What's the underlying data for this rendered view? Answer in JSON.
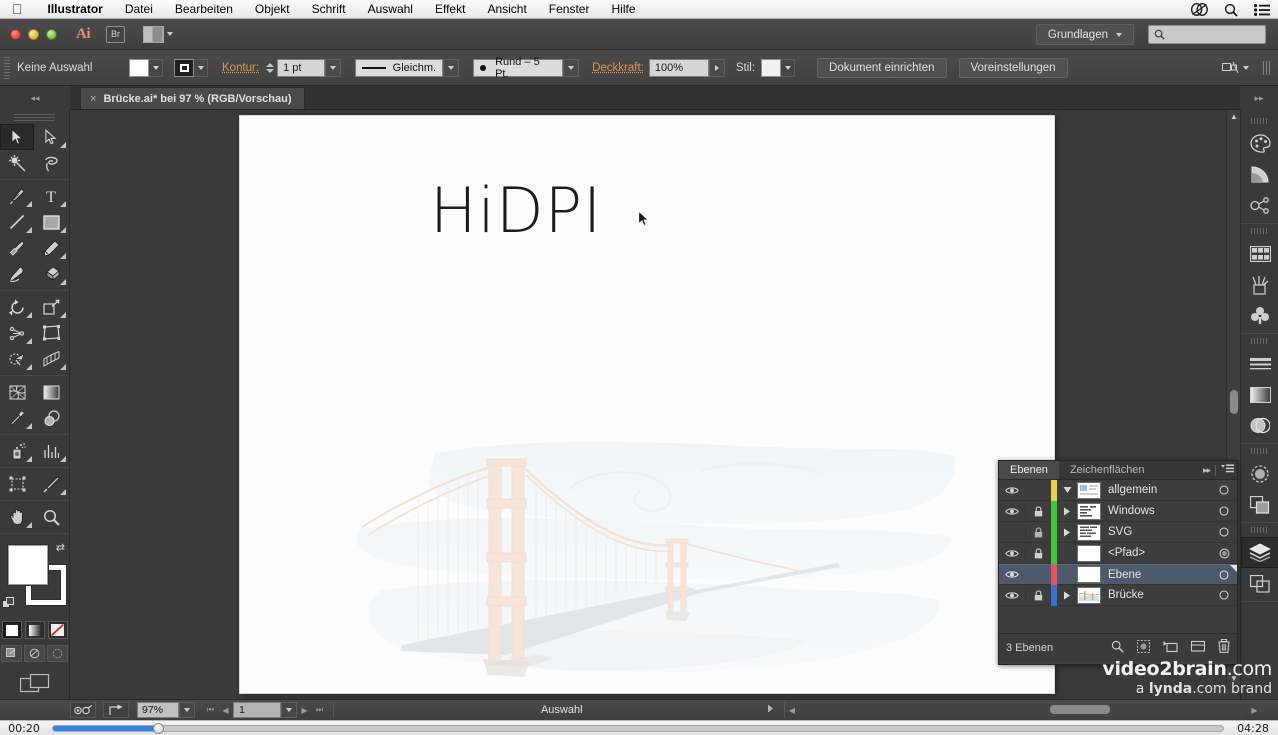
{
  "mac_menu": {
    "apple_icon": "apple-logo-icon",
    "items": [
      {
        "label": "Illustrator",
        "bold": true
      },
      {
        "label": "Datei",
        "bold": false
      },
      {
        "label": "Bearbeiten",
        "bold": false
      },
      {
        "label": "Objekt",
        "bold": false
      },
      {
        "label": "Schrift",
        "bold": false
      },
      {
        "label": "Auswahl",
        "bold": false
      },
      {
        "label": "Effekt",
        "bold": false
      },
      {
        "label": "Ansicht",
        "bold": false
      },
      {
        "label": "Fenster",
        "bold": false
      },
      {
        "label": "Hilfe",
        "bold": false
      }
    ],
    "right_icons": [
      "creative-cloud-icon",
      "spotlight-search-icon",
      "notification-list-icon"
    ]
  },
  "appbar": {
    "window_controls": [
      "close",
      "minimize",
      "zoom"
    ],
    "app_logo": "Ai",
    "bridge_button": "Br",
    "arrange_documents": "arrange-documents-icon",
    "workspace_label": "Grundlagen",
    "search_placeholder": ""
  },
  "control_bar": {
    "selection_status": "Keine Auswahl",
    "fill_color": "#ffffff",
    "stroke_label": "Kontur:",
    "stroke_weight": "1 pt",
    "stroke_profile": "Gleichm.",
    "brush_definition": "Rund – 5 Pt.",
    "opacity_label": "Deckkraft:",
    "opacity_value": "100%",
    "style_label": "Stil:",
    "document_setup_button": "Dokument einrichten",
    "preferences_button": "Voreinstellungen"
  },
  "tabs": {
    "document": {
      "title": "Brücke.ai* bei 97 % (RGB/Vorschau)",
      "close": "×"
    }
  },
  "canvas": {
    "artwork_text": "HiDPI",
    "artwork_illustration": "golden-gate-bridge-watercolor"
  },
  "tools": {
    "rows": [
      [
        {
          "name": "selection-tool",
          "icon": "arrow-solid",
          "selected": true,
          "flyout": false
        },
        {
          "name": "direct-selection-tool",
          "icon": "arrow-outline",
          "selected": false,
          "flyout": true
        }
      ],
      [
        {
          "name": "magic-wand-tool",
          "icon": "magic-wand",
          "selected": false,
          "flyout": false
        },
        {
          "name": "lasso-tool",
          "icon": "lasso",
          "selected": false,
          "flyout": false
        }
      ],
      [
        {
          "name": "pen-tool",
          "icon": "pen-nib",
          "selected": false,
          "flyout": true
        },
        {
          "name": "type-tool",
          "icon": "type-T",
          "selected": false,
          "flyout": true
        }
      ],
      [
        {
          "name": "line-segment-tool",
          "icon": "line-diagonal",
          "selected": false,
          "flyout": true
        },
        {
          "name": "rectangle-tool",
          "icon": "rectangle",
          "selected": false,
          "flyout": true
        }
      ],
      [
        {
          "name": "paintbrush-tool",
          "icon": "paintbrush",
          "selected": false,
          "flyout": false
        },
        {
          "name": "pencil-tool",
          "icon": "pencil",
          "selected": false,
          "flyout": true
        }
      ],
      [
        {
          "name": "blob-brush-tool",
          "icon": "blob-brush",
          "selected": false,
          "flyout": false
        },
        {
          "name": "eraser-tool",
          "icon": "eraser",
          "selected": false,
          "flyout": true
        }
      ],
      [
        {
          "name": "rotate-tool",
          "icon": "rotate",
          "selected": false,
          "flyout": true
        },
        {
          "name": "scale-tool",
          "icon": "scale",
          "selected": false,
          "flyout": true
        }
      ],
      [
        {
          "name": "width-tool",
          "icon": "width",
          "selected": false,
          "flyout": true
        },
        {
          "name": "free-transform-tool",
          "icon": "free-transform",
          "selected": false,
          "flyout": false
        }
      ],
      [
        {
          "name": "shape-builder-tool",
          "icon": "shape-builder",
          "selected": false,
          "flyout": true
        },
        {
          "name": "perspective-grid-tool",
          "icon": "perspective-grid",
          "selected": false,
          "flyout": true
        }
      ],
      [
        {
          "name": "mesh-tool",
          "icon": "mesh",
          "selected": false,
          "flyout": false
        },
        {
          "name": "gradient-tool",
          "icon": "gradient",
          "selected": false,
          "flyout": false
        }
      ],
      [
        {
          "name": "eyedropper-tool",
          "icon": "eyedropper",
          "selected": false,
          "flyout": true
        },
        {
          "name": "blend-tool",
          "icon": "blend",
          "selected": false,
          "flyout": false
        }
      ],
      [
        {
          "name": "symbol-sprayer-tool",
          "icon": "symbol-sprayer",
          "selected": false,
          "flyout": true
        },
        {
          "name": "column-graph-tool",
          "icon": "bar-graph",
          "selected": false,
          "flyout": true
        }
      ],
      [
        {
          "name": "artboard-tool",
          "icon": "artboard",
          "selected": false,
          "flyout": false
        },
        {
          "name": "slice-tool",
          "icon": "slice-knife",
          "selected": false,
          "flyout": true
        }
      ],
      [
        {
          "name": "hand-tool",
          "icon": "hand",
          "selected": false,
          "flyout": true
        },
        {
          "name": "zoom-tool",
          "icon": "magnifier",
          "selected": false,
          "flyout": false
        }
      ]
    ],
    "fill_color": "#ffffff",
    "stroke_color": "#ffffff",
    "paint_modes": [
      "color-swatch",
      "gradient-swatch",
      "none-swatch"
    ],
    "screen_modes": [
      "normal-screen-mode",
      "full-screen-menu-bar",
      "full-screen-mode"
    ]
  },
  "right_dock": {
    "groups": [
      [
        {
          "name": "color-panel-icon"
        },
        {
          "name": "color-guide-panel-icon"
        },
        {
          "name": "edit-colors-panel-icon"
        }
      ],
      [
        {
          "name": "swatches-panel-icon"
        },
        {
          "name": "brushes-panel-icon"
        },
        {
          "name": "symbols-panel-icon"
        }
      ],
      [
        {
          "name": "stroke-panel-icon"
        },
        {
          "name": "gradient-panel-icon"
        },
        {
          "name": "transparency-panel-icon"
        }
      ],
      [
        {
          "name": "appearance-panel-icon"
        },
        {
          "name": "pathfinder-panel-icon"
        }
      ],
      [
        {
          "name": "layers-panel-icon",
          "selected": true
        },
        {
          "name": "artboards-panel-icon"
        }
      ]
    ]
  },
  "layers_panel": {
    "tabs": [
      {
        "label": "Ebenen",
        "active": true
      },
      {
        "label": "Zeichenflächen",
        "active": false
      }
    ],
    "expand_icon": "double-chevron-right-icon",
    "menu_icon": "panel-menu-icon",
    "rows": [
      {
        "name": "allgemein",
        "visible": true,
        "locked": false,
        "color": "#e8d24a",
        "expandable": true,
        "expanded": true,
        "indent": 0,
        "selected": false,
        "thumb": "group-thumb"
      },
      {
        "name": "Windows",
        "visible": true,
        "locked": true,
        "color": "#3cc93c",
        "expandable": true,
        "expanded": false,
        "indent": 1,
        "selected": false,
        "thumb": "text-thumb"
      },
      {
        "name": "SVG",
        "visible": false,
        "locked": true,
        "color": "#3cc93c",
        "expandable": true,
        "expanded": false,
        "indent": 1,
        "selected": false,
        "thumb": "text-thumb"
      },
      {
        "name": "<Pfad>",
        "visible": true,
        "locked": true,
        "color": "#3cc93c",
        "expandable": false,
        "expanded": false,
        "indent": 1,
        "selected": false,
        "thumb": "blank-thumb"
      },
      {
        "name": "Ebene",
        "visible": true,
        "locked": false,
        "color": "#e8506a",
        "expandable": false,
        "expanded": false,
        "indent": 0,
        "selected": true,
        "thumb": "blank-thumb"
      },
      {
        "name": "Brücke",
        "visible": true,
        "locked": true,
        "color": "#3b6fd4",
        "expandable": true,
        "expanded": false,
        "indent": 0,
        "selected": false,
        "thumb": "image-thumb"
      }
    ],
    "footer": {
      "count_label": "3 Ebenen",
      "icons": [
        "locate-object-icon",
        "make-clipping-mask-icon",
        "create-new-sublayer-icon",
        "create-new-layer-icon",
        "delete-selection-icon"
      ]
    }
  },
  "watermark": {
    "line1_bold": "video2brain",
    "line1_rest": ".com",
    "line2_pre": "a ",
    "line2_bold": "lynda",
    "line2_rest": ".com brand"
  },
  "status_bar": {
    "zoom_level": "97%",
    "page_number": "1",
    "status_text": "Auswahl"
  },
  "player": {
    "elapsed": "00:20",
    "total": "04:28",
    "progress_percent": 9
  },
  "colors": {
    "accent_orange": "#d99a56",
    "selection_blue": "#4d5a6b",
    "progress_blue": "#2f82e8",
    "panel_bg": "#3d3d3d",
    "chrome_bg": "#3a3a3a"
  }
}
